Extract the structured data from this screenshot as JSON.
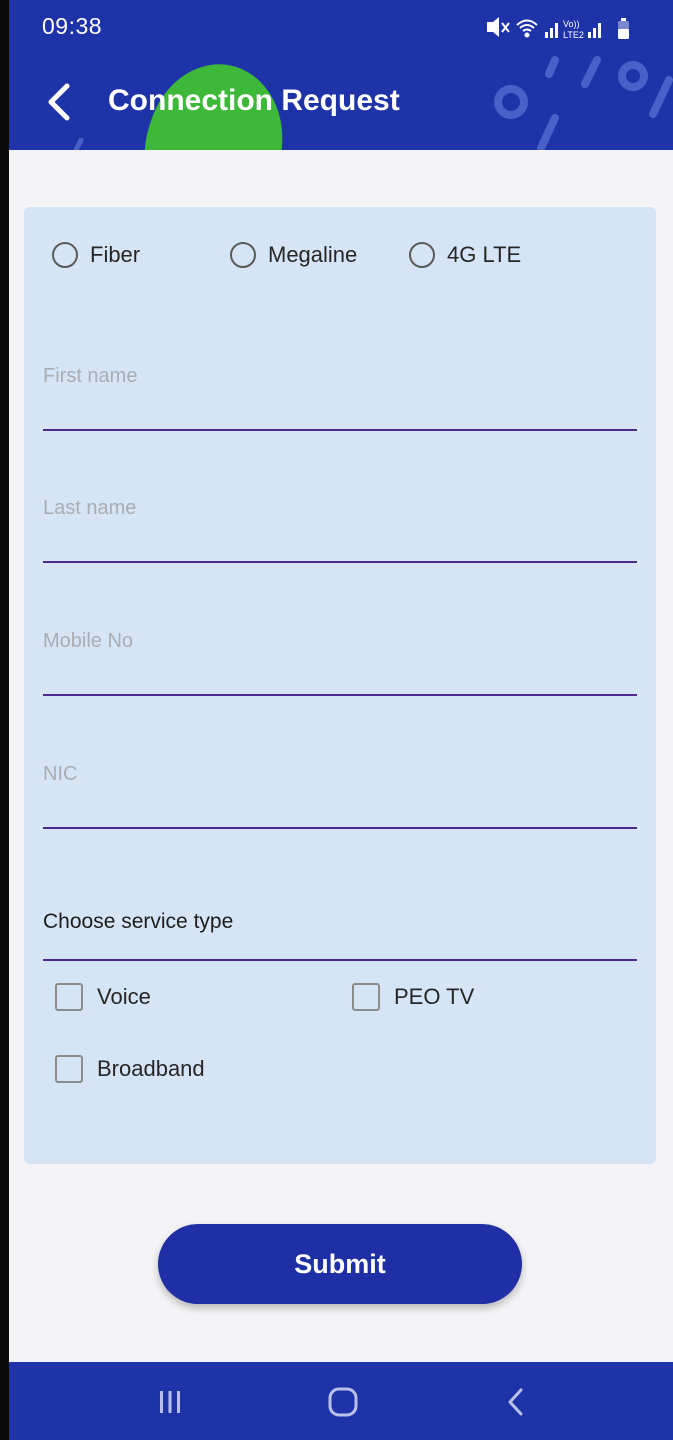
{
  "status_bar": {
    "time": "09:38",
    "icons": [
      "mute-icon",
      "wifi-icon",
      "signal-icon",
      "volte-icon",
      "signal-icon",
      "battery-icon"
    ],
    "volte_text": "Vo))",
    "lte_text": "LTE2"
  },
  "header": {
    "title": "Connection Request",
    "back_icon": "chevron-left-icon",
    "colors": {
      "background": "#1f33a8",
      "accent": "#3db838"
    }
  },
  "form": {
    "connection_types": [
      {
        "label": "Fiber",
        "selected": false
      },
      {
        "label": "Megaline",
        "selected": false
      },
      {
        "label": "4G LTE",
        "selected": false
      }
    ],
    "fields": {
      "first_name": {
        "placeholder": "First name",
        "value": ""
      },
      "last_name": {
        "placeholder": "Last name",
        "value": ""
      },
      "mobile_no": {
        "placeholder": "Mobile No",
        "value": ""
      },
      "nic": {
        "placeholder": "NIC",
        "value": ""
      }
    },
    "service_type": {
      "label": "Choose service type"
    },
    "services": [
      {
        "label": "Voice",
        "checked": false
      },
      {
        "label": "PEO TV",
        "checked": false
      },
      {
        "label": "Broadband",
        "checked": false
      }
    ],
    "submit_label": "Submit"
  },
  "nav_bar": {
    "icons": [
      "recent-apps-icon",
      "home-icon",
      "back-icon"
    ]
  }
}
